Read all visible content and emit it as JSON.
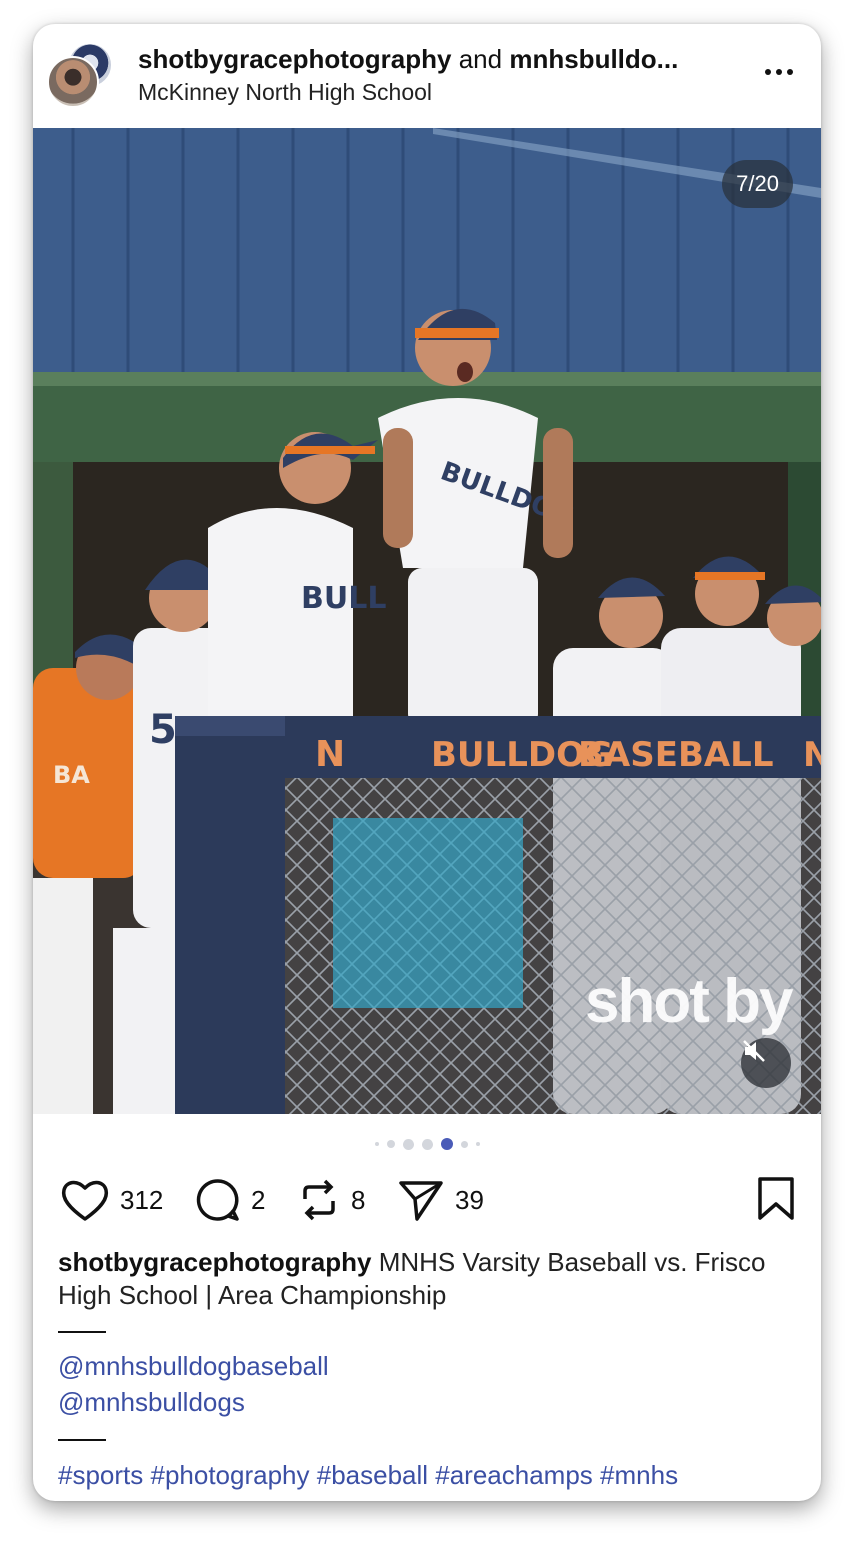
{
  "post": {
    "author_primary": "shotbygracephotography",
    "joiner": "and",
    "author_secondary": "mnhsbulldo...",
    "location": "McKinney North High School",
    "slide_counter": "7/20",
    "watermark": "shot by",
    "photo_text": {
      "padding_left": "N",
      "padding_center": "BULLDOG",
      "padding_right": "BASEBALL",
      "padding_far_right": "N",
      "jersey_center": "BULLDOG",
      "jersey_left": "BULL",
      "jersey_number": "5",
      "orange_shirt": "BA"
    }
  },
  "carousel": {
    "total_dots": 7,
    "active_index": 4
  },
  "actions": {
    "likes": "312",
    "comments": "2",
    "reposts": "8",
    "shares": "39"
  },
  "caption": {
    "author": "shotbygracephotography",
    "text": "MNHS Varsity Baseball vs. Frisco High School | Area Championship",
    "mention_1": "@mnhsbulldogbaseball",
    "mention_2": "@mnhsbulldogs",
    "hashtags": "#sports #photography #baseball #areachamps #mnhs"
  },
  "icons": {
    "more": "more-horizontal-icon",
    "like": "heart-icon",
    "comment": "comment-bubble-icon",
    "repost": "repost-icon",
    "share": "send-icon",
    "save": "bookmark-icon",
    "mute": "speaker-muted-icon"
  },
  "colors": {
    "link": "#3b4fa4",
    "active_dot": "#4a5bb8"
  }
}
